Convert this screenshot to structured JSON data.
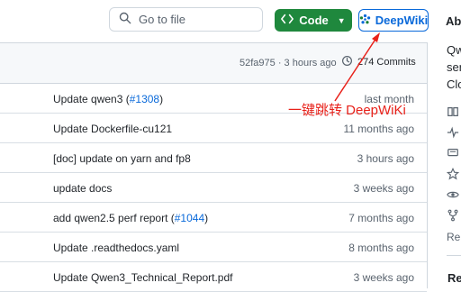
{
  "header": {
    "search_placeholder": "Go to file",
    "code_label": "Code",
    "deepwiki_label": "DeepWiki"
  },
  "about": {
    "heading": "Ab"
  },
  "commit_bar": {
    "hash": "52fa975",
    "separator": " · ",
    "time": "3 hours ago",
    "commits_label": "274 Commits"
  },
  "files": [
    {
      "message": "Update qwen3 (",
      "pr": "#1308",
      "message_end": ")",
      "time": "last month"
    },
    {
      "message": "Update Dockerfile-cu121",
      "pr": "",
      "message_end": "",
      "time": "11 months ago"
    },
    {
      "message": "[doc] update on yarn and fp8",
      "pr": "",
      "message_end": "",
      "time": "3 hours ago"
    },
    {
      "message": "update docs",
      "pr": "",
      "message_end": "",
      "time": "3 weeks ago"
    },
    {
      "message": "add qwen2.5 perf report (",
      "pr": "#1044",
      "message_end": ")",
      "time": "7 months ago"
    },
    {
      "message": "Update .readthedocs.yaml",
      "pr": "",
      "message_end": "",
      "time": "8 months ago"
    },
    {
      "message": "Update Qwen3_Technical_Report.pdf",
      "pr": "",
      "message_end": "",
      "time": "3 weeks ago"
    }
  ],
  "sidebar": {
    "desc_lines": [
      "Qw",
      "ser",
      "Clo"
    ],
    "icons": [
      "book-icon",
      "pulse-icon",
      "comment-icon",
      "star-icon",
      "eye-icon",
      "fork-icon"
    ],
    "rep": "Rep",
    "re_heading": "Re"
  },
  "annotation": {
    "text": "一键跳转 DeepWiKi",
    "color": "#e8211a"
  }
}
